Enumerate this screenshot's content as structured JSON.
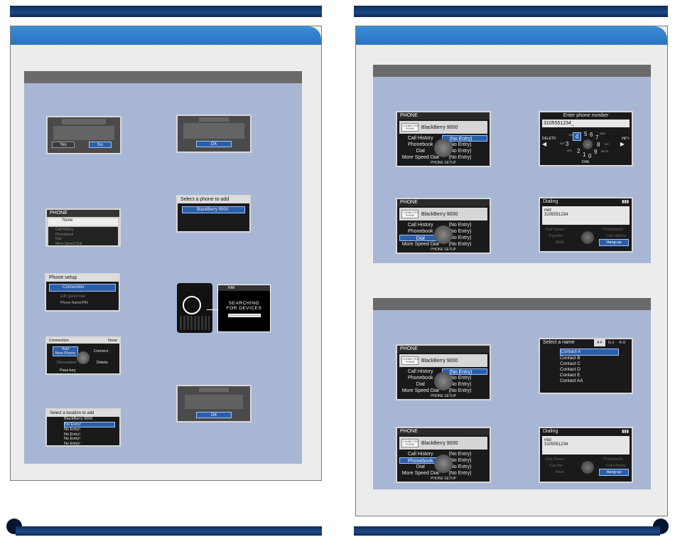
{
  "colors": {
    "navy": "#0f2c5c",
    "tab_blue": "#2a72c0",
    "section_bg": "#a8b6d6",
    "section_bar": "#6a6a6a",
    "highlight": "#2a5ea8"
  },
  "left": {
    "screen_a": {
      "yes": "Yes",
      "no": "No"
    },
    "screen_b": {
      "ok": "OK"
    },
    "screen_c": {
      "title": "PHONE",
      "header": "None",
      "rows": [
        "Call History",
        "Phonebook",
        "Dial",
        "More Speed Dial"
      ]
    },
    "screen_d": {
      "title": "Select a phone to add",
      "item": "BlackBerry 9000"
    },
    "screen_e": {
      "title": "Phone setup",
      "items": [
        "Connection",
        "Edit Speed Dial",
        "Phone Name/PIN"
      ]
    },
    "screen_f": {
      "brand": "RIM",
      "msg1": "SEARCHING",
      "msg2": "FOR DEVICES"
    },
    "screen_g": {
      "title": "Connection",
      "status": "None",
      "add1": "Add",
      "add2": "New Phone",
      "connect": "Connect",
      "disconnect": "Disconnect",
      "delete": "Delete",
      "passkey": "Pass-key"
    },
    "screen_h": {
      "ok": "OK"
    },
    "screen_i": {
      "title": "Select a location to add",
      "items": [
        "BlackBerry 9000",
        "No Entry!",
        "No Entry!",
        "No Entry!",
        "No Entry!",
        "No Entry!"
      ]
    }
  },
  "right": {
    "phone": {
      "title": "PHONE",
      "logo": "CONNECTED PHONE",
      "device": "BlackBerry 9000",
      "rows": [
        {
          "label": "Call History",
          "value": "(No Entry)"
        },
        {
          "label": "Phonebook",
          "value": "(No Entry)"
        },
        {
          "label": "Dial",
          "value": "(No Entry)"
        },
        {
          "label": "More Speed Dial",
          "value": "(No Entry)"
        }
      ],
      "footer": "PHONE SETUP"
    },
    "enter": {
      "title": "Enter phone number",
      "number": "3105551234_",
      "delete": "DELETE",
      "hash": "#&*+",
      "dial": "DIAL",
      "digits": [
        "4",
        "5",
        "6",
        "3",
        "7",
        "2",
        "8",
        "1",
        "0",
        "9"
      ],
      "letters": [
        "GHI",
        "JKL",
        "MNO",
        "DEF",
        "PQRS",
        "ABC",
        "TUV",
        "WXYZ"
      ]
    },
    "dialing": {
      "title": "Dialing",
      "icon_label": "Ⓟ",
      "name": "mid",
      "number": "3105551234",
      "buttons": [
        "Dial Tones",
        "Phonebook",
        "Transfer",
        "Call History",
        "Mute",
        "Hang-up"
      ]
    },
    "select_name": {
      "title": "Select a name",
      "tabs": [
        "A-F",
        "G-J",
        "K-O"
      ],
      "contacts": [
        "Contact A",
        "Contact B",
        "Contact C",
        "Contact D",
        "Contact E",
        "Contact AA"
      ]
    }
  }
}
